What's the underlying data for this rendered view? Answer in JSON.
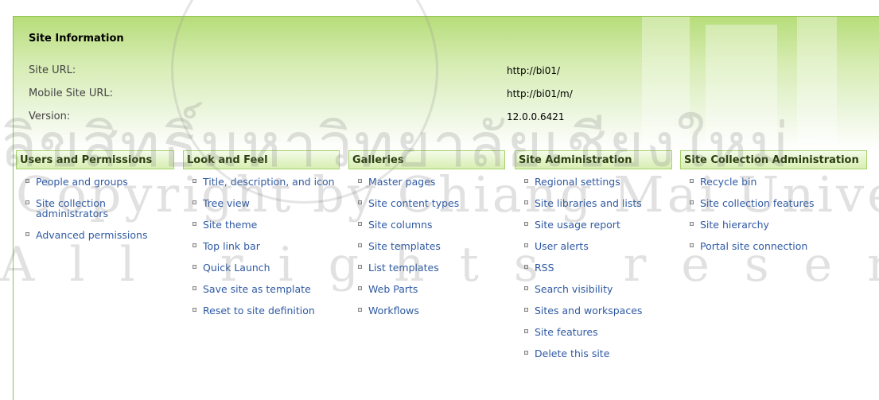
{
  "site_info": {
    "title": "Site Information",
    "rows": [
      {
        "label": "Site URL:",
        "value": "http://bi01/"
      },
      {
        "label": "Mobile Site URL:",
        "value": "http://bi01/m/"
      },
      {
        "label": "Version:",
        "value": "12.0.0.6421"
      }
    ]
  },
  "watermark": {
    "line1": "ลิขสิทธิ์มหาวิทยาลัยเชียงใหม่",
    "line2": "Copyright by Chiang Mai University",
    "line3": "All rights reserved"
  },
  "columns": [
    {
      "header": "Users and Permissions",
      "items": [
        "People and groups",
        "Site collection administrators",
        "Advanced permissions"
      ]
    },
    {
      "header": "Look and Feel",
      "items": [
        "Title, description, and icon",
        "Tree view",
        "Site theme",
        "Top link bar",
        "Quick Launch",
        "Save site as template",
        "Reset to site definition"
      ]
    },
    {
      "header": "Galleries",
      "items": [
        "Master pages",
        "Site content types",
        "Site columns",
        "Site templates",
        "List templates",
        "Web Parts",
        "Workflows"
      ]
    },
    {
      "header": "Site Administration",
      "items": [
        "Regional settings",
        "Site libraries and lists",
        "Site usage report",
        "User alerts",
        "RSS",
        "Search visibility",
        "Sites and workspaces",
        "Site features",
        "Delete this site"
      ]
    },
    {
      "header": "Site Collection Administration",
      "items": [
        "Recycle bin",
        "Site collection features",
        "Site hierarchy",
        "Portal site connection"
      ]
    }
  ]
}
